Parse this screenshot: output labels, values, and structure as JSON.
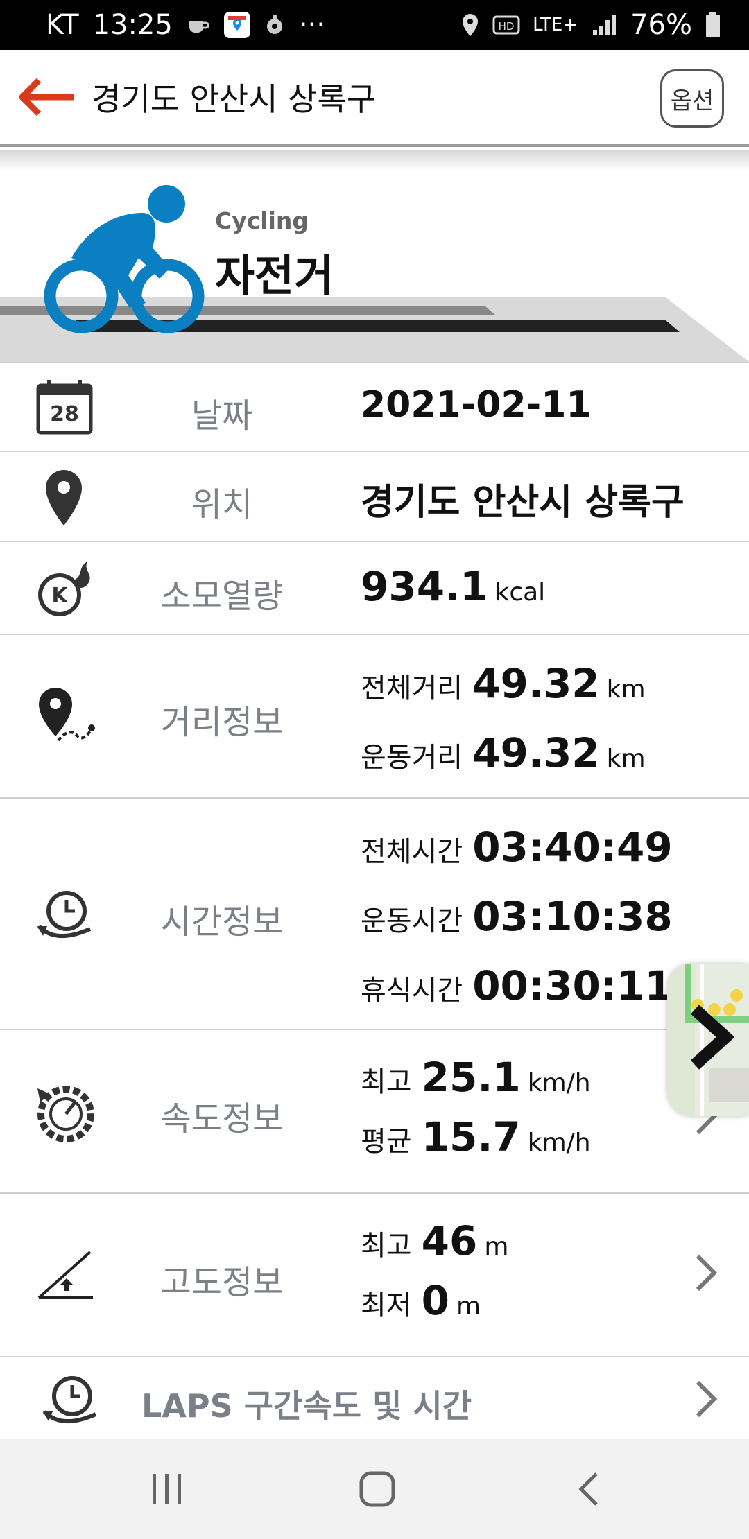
{
  "status_bar": {
    "carrier": "KT",
    "time": "13:25",
    "dots": "···",
    "network": "LTE+",
    "battery": "76%"
  },
  "header": {
    "title": "경기도 안산시 상록구",
    "option_label": "옵션"
  },
  "activity": {
    "type_en": "Cycling",
    "type_ko": "자전거",
    "icon_color": "#0a7fc2"
  },
  "rows": {
    "date": {
      "label": "날짜",
      "value": "2021-02-11",
      "calendar_day": "28"
    },
    "location": {
      "label": "위치",
      "value": "경기도 안산시 상록구"
    },
    "calories": {
      "label": "소모열량",
      "value": "934.1",
      "unit": "kcal"
    },
    "distance": {
      "label": "거리정보",
      "total_label": "전체거리",
      "total_value": "49.32",
      "total_unit": "km",
      "move_label": "운동거리",
      "move_value": "49.32",
      "move_unit": "km"
    },
    "time": {
      "label": "시간정보",
      "total_label": "전체시간",
      "total_value": "03:40:49",
      "move_label": "운동시간",
      "move_value": "03:10:38",
      "rest_label": "휴식시간",
      "rest_value": "00:30:11"
    },
    "speed": {
      "label": "속도정보",
      "max_label": "최고",
      "max_value": "25.1",
      "max_unit": "km/h",
      "avg_label": "평균",
      "avg_value": "15.7",
      "avg_unit": "km/h"
    },
    "altitude": {
      "label": "고도정보",
      "max_label": "최고",
      "max_value": "46",
      "max_unit": "m",
      "min_label": "최저",
      "min_value": "0",
      "min_unit": "m"
    },
    "laps": {
      "label": "LAPS 구간속도 및 시간"
    }
  },
  "colors": {
    "accent_red": "#d93a1a",
    "label_gray": "#7a7f88"
  }
}
